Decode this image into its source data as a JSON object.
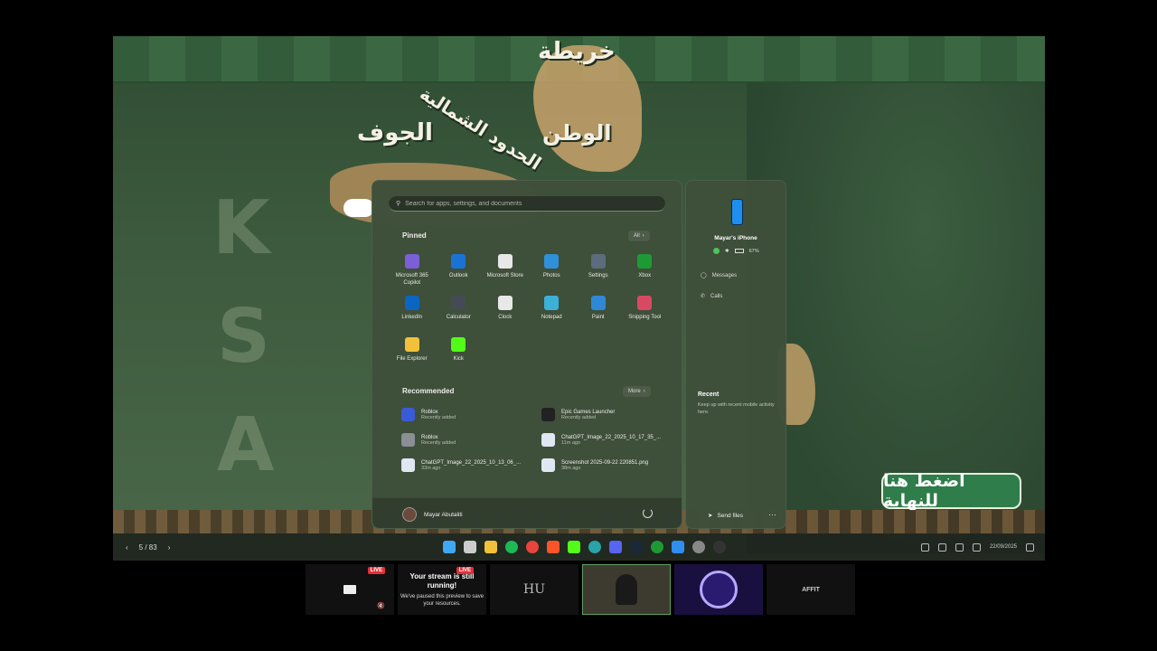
{
  "wallpaper": {
    "labels": [
      "خريطة",
      "الوطن",
      "الحدود الشمالية",
      "الجوف"
    ],
    "ksa_letters": [
      "K",
      "S",
      "A"
    ],
    "cta_label": "اضغط هنا للنهاية"
  },
  "slideshow": {
    "counter": "5 / 83",
    "prev_glyph": "‹",
    "next_glyph": "›"
  },
  "start_menu": {
    "search_placeholder": "Search for apps, settings, and documents",
    "pinned_title": "Pinned",
    "all_label": "All",
    "pinned_apps": [
      {
        "label": "Microsoft 365 Copilot",
        "icon": "copilot-icon",
        "color": "#7a5fd6"
      },
      {
        "label": "Outlook",
        "icon": "outlook-icon",
        "color": "#1a73d4"
      },
      {
        "label": "Microsoft Store",
        "icon": "store-icon",
        "color": "#e8e8e8"
      },
      {
        "label": "Photos",
        "icon": "photos-icon",
        "color": "#2f8fd8"
      },
      {
        "label": "Settings",
        "icon": "gear-icon",
        "color": "#5c6c7d"
      },
      {
        "label": "Xbox",
        "icon": "xbox-icon",
        "color": "#1e9a35"
      },
      {
        "label": "LinkedIn",
        "icon": "linkedin-icon",
        "color": "#0a66c2"
      },
      {
        "label": "Calculator",
        "icon": "calculator-icon",
        "color": "#444b55"
      },
      {
        "label": "Clock",
        "icon": "clock-icon",
        "color": "#e8e8e8"
      },
      {
        "label": "Notepad",
        "icon": "notepad-icon",
        "color": "#3bb0d8"
      },
      {
        "label": "Paint",
        "icon": "paint-icon",
        "color": "#2e88d6"
      },
      {
        "label": "Snipping Tool",
        "icon": "snipping-tool-icon",
        "color": "#d84a64"
      },
      {
        "label": "File Explorer",
        "icon": "folder-icon",
        "color": "#f1c13b"
      },
      {
        "label": "Kick",
        "icon": "kick-icon",
        "color": "#53fc18"
      }
    ],
    "recommended_title": "Recommended",
    "more_label": "More",
    "recommended": [
      {
        "name": "Roblox",
        "sub": "Recently added",
        "icon": "roblox-icon",
        "color": "#3a5bd6"
      },
      {
        "name": "Epic Games Launcher",
        "sub": "Recently added",
        "icon": "epic-games-icon",
        "color": "#222222"
      },
      {
        "name": "Roblox",
        "sub": "Recently added",
        "icon": "roblox-icon",
        "color": "#8a8f96"
      },
      {
        "name": "ChatGPT_Image_22_2025_10_17_35_...",
        "sub": "11m ago",
        "icon": "image-file-icon",
        "color": "#dfe7f2"
      },
      {
        "name": "ChatGPT_Image_22_2025_10_13_06_...",
        "sub": "33m ago",
        "icon": "image-file-icon",
        "color": "#dfe7f2"
      },
      {
        "name": "Screenshot 2025-09-22 220851.png",
        "sub": "38m ago",
        "icon": "image-file-icon",
        "color": "#dfe7f2"
      }
    ],
    "user_name": "Mayar Abutaliti"
  },
  "phone_panel": {
    "device_name": "Mayar's iPhone",
    "battery": "67%",
    "messages_label": "Messages",
    "calls_label": "Calls",
    "recent_title": "Recent",
    "recent_sub": "Keep up with recent mobile activity here.",
    "send_files_label": "Send files"
  },
  "taskbar": {
    "clock_date": "22/09/2025"
  },
  "strip": {
    "live_badge": "LIVE",
    "paused_title": "Your stream is still running!",
    "paused_sub": "We've paused this preview to save your resources.",
    "monogram": "HU",
    "tile_label": "AFFIT"
  },
  "colors": {
    "accent_green": "#2f7d4a",
    "live_red": "#e4303a",
    "active_border": "#5da060"
  }
}
